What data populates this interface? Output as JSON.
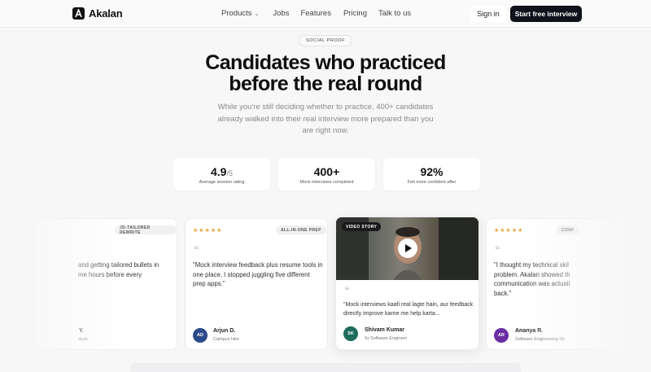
{
  "nav": {
    "brand": "Akalan",
    "links": [
      "Products",
      "Jobs",
      "Features",
      "Pricing",
      "Talk to us"
    ],
    "signin": "Sign in",
    "cta": "Start free interview"
  },
  "hero": {
    "pill": "SOCIAL PROOF",
    "headline_line1": "Candidates who practiced",
    "headline_line2": "before the real round",
    "subtitle": "While you're still deciding whether to practice, 400+ candidates already walked into their real interview more prepared than you are right now."
  },
  "stats": [
    {
      "value": "4.9",
      "unit": "/5",
      "label": "Average session rating"
    },
    {
      "value": "400+",
      "unit": "",
      "label": "Mock interviews completed"
    },
    {
      "value": "92%",
      "unit": "",
      "label": "Felt more confident after"
    }
  ],
  "cards": [
    {
      "stars": "★★★★★",
      "tag": "JD-TAILORED REWRITE",
      "quote": "...and getting tailored bullets in the hours before every",
      "quote_line1": "and getting tailored bullets in",
      "quote_line2": "me hours before every",
      "name": "...",
      "role": "...alyst"
    },
    {
      "stars": "★★★★★",
      "tag": "ALL-IN-ONE PREP",
      "quote": "\"Mock interview feedback plus resume tools in one place. I stopped juggling five different prep apps.\"",
      "initials": "AD",
      "name": "Arjun D.",
      "role": "Campus Hire",
      "avatar_color": "#2b4a8c"
    },
    {
      "video_badge": "VIDEO STORY",
      "quote": "\"Mock interviews kaafi real lagte hain, aur feedback directly improve karne me help karta...",
      "initials": "SK",
      "name": "Shivam Kumar",
      "role": "Sr Software Engineer",
      "avatar_color": "#1f6b5c"
    },
    {
      "stars": "★★★★★",
      "tag": "CONF",
      "quote": "\"I thought my technical skills were the problem. Akalan showed the communication was actually holding me back.\"",
      "quote_line1": "\"I thought my technical skil",
      "quote_line2": "problem. Akalan showed th",
      "quote_line3": "communication was actuall",
      "quote_line4": "back.\"",
      "initials": "AR",
      "name": "Ananya R.",
      "role": "Software Engineering Sh",
      "avatar_color": "#6b2fa3"
    }
  ],
  "colors": {
    "accent_dark": "#0f1218",
    "star": "#e9a23b",
    "background": "#f7f7f8"
  },
  "icons": {
    "logo": "logo-mark-icon",
    "chevron": "chevron-down-icon",
    "play": "play-icon",
    "quote": "quote-icon"
  }
}
